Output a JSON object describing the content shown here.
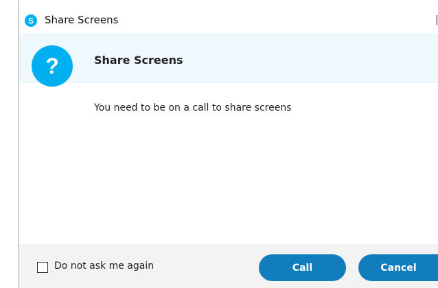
{
  "window": {
    "title": "Share Screens",
    "app_icon": "skype-icon",
    "close_icon": "close-icon"
  },
  "header": {
    "icon": "question-icon",
    "heading": "Share Screens"
  },
  "body": {
    "message": "You need to be on a call to share screens"
  },
  "footer": {
    "checkbox_label": "Do not ask me again",
    "checkbox_checked": false,
    "call_label": "Call",
    "cancel_label": "Cancel"
  },
  "colors": {
    "accent": "#00aff0",
    "button": "#117dbd",
    "header_band": "#eff8fc",
    "footer_band": "#f3f3f3"
  }
}
